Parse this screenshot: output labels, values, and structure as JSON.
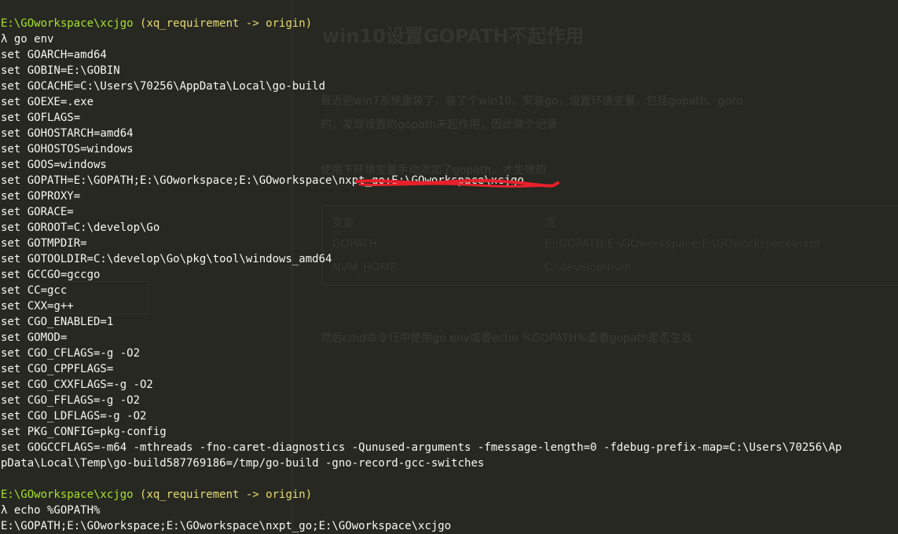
{
  "background_blog": {
    "title": "win10设置GOPATH不起作用",
    "paragraph1a": "最近把win7系统重装了，装了个win10，安装go，设置环境变量，包括gopath、goro",
    "paragraph1b": "的，发现设置的gopath未起作用，因此做个记录",
    "paragraph2": "使用下环境变量手动添加了gopath，才生效的",
    "table": {
      "headers": [
        "变量",
        "值"
      ],
      "rows": [
        [
          "GOPATH",
          "E:\\GOPATH;E:\\GOworkspace;E:\\GOworkspace\\nxpt"
        ],
        [
          "NVM_HOME",
          "C:\\develop\\nvm"
        ]
      ]
    },
    "paragraph3": "然后cmd命令行中使用go env或者echo %GOPATH%查看gopath是否生效"
  },
  "terminal": {
    "prompt1": {
      "path": "E:\\GOworkspace\\xcjgo",
      "branch": "(xq_requirement -> origin)"
    },
    "command1": "λ go env",
    "env": [
      "set GOARCH=amd64",
      "set GOBIN=E:\\GOBIN",
      "set GOCACHE=C:\\Users\\70256\\AppData\\Local\\go-build",
      "set GOEXE=.exe",
      "set GOFLAGS=",
      "set GOHOSTARCH=amd64",
      "set GOHOSTOS=windows",
      "set GOOS=windows",
      "set GOPATH=E:\\GOPATH;E:\\GOworkspace;E:\\GOworkspace\\nxpt_go;E:\\GOworkspace\\xcjgo",
      "set GOPROXY=",
      "set GORACE=",
      "set GOROOT=C:\\develop\\Go",
      "set GOTMPDIR=",
      "set GOTOOLDIR=C:\\develop\\Go\\pkg\\tool\\windows_amd64",
      "set GCCGO=gccgo",
      "set CC=gcc",
      "set CXX=g++",
      "set CGO_ENABLED=1",
      "set GOMOD=",
      "set CGO_CFLAGS=-g -O2",
      "set CGO_CPPFLAGS=",
      "set CGO_CXXFLAGS=-g -O2",
      "set CGO_FFLAGS=-g -O2",
      "set CGO_LDFLAGS=-g -O2",
      "set PKG_CONFIG=pkg-config",
      "set GOGCCFLAGS=-m64 -mthreads -fno-caret-diagnostics -Qunused-arguments -fmessage-length=0 -fdebug-prefix-map=C:\\Users\\70256\\Ap",
      "pData\\Local\\Temp\\go-build587769186=/tmp/go-build -gno-record-gcc-switches"
    ],
    "blank": "",
    "prompt2": {
      "path": "E:\\GOworkspace\\xcjgo",
      "branch": "(xq_requirement -> origin)"
    },
    "command2": "λ echo %GOPATH%",
    "output2": "E:\\GOPATH;E:\\GOworkspace;E:\\GOworkspace\\nxpt_go;E:\\GOworkspace\\xcjgo"
  },
  "colors": {
    "background": "#272822",
    "text": "#f8f8f2",
    "path": "#a6e22e",
    "branch": "#e6db74",
    "redaction": "#e8202a"
  }
}
